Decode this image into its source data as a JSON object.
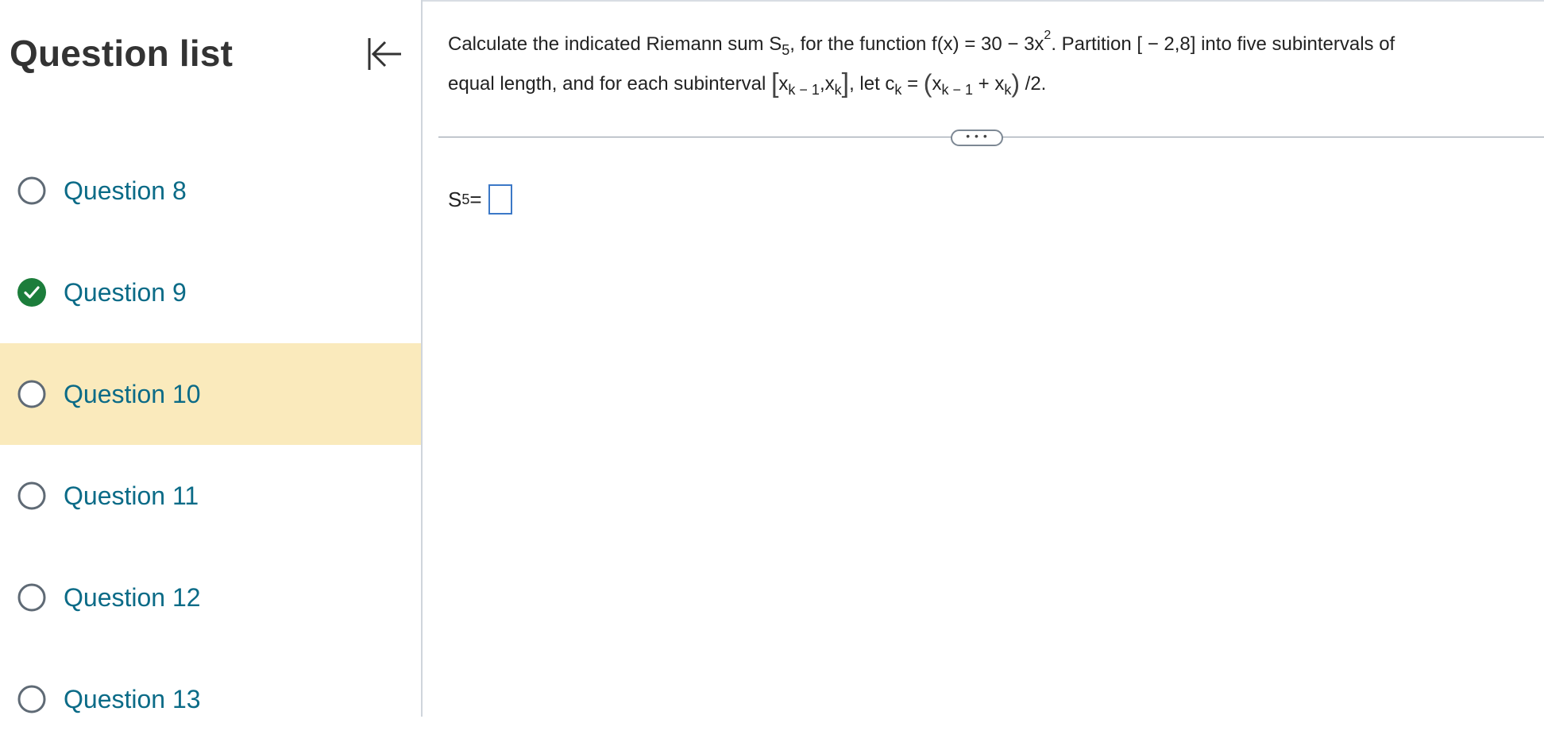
{
  "sidebar": {
    "title": "Question list",
    "collapse_icon": "collapse-left-icon",
    "items": [
      {
        "label": "Question 8",
        "status": "unanswered",
        "current": false
      },
      {
        "label": "Question 9",
        "status": "completed",
        "current": false
      },
      {
        "label": "Question 10",
        "status": "unanswered",
        "current": true
      },
      {
        "label": "Question 11",
        "status": "unanswered",
        "current": false
      },
      {
        "label": "Question 12",
        "status": "unanswered",
        "current": false
      },
      {
        "label": "Question 13",
        "status": "unanswered",
        "current": false
      }
    ]
  },
  "question": {
    "line1": {
      "lead": "Calculate the indicated Riemann sum S",
      "lead_sub": "5",
      "mid": ", for the function f(x) = 30 − 3x",
      "mid_sup": "2",
      "tail": ".  Partition [ − 2,8] into five subintervals of"
    },
    "line2": {
      "lead": "equal length, and for each subinterval",
      "interval_a": "x",
      "interval_a_sub": "k − 1",
      "interval_sep": ",",
      "interval_b": "x",
      "interval_b_sub": "k",
      "let": ", let c",
      "let_sub": "k",
      "equals": " = ",
      "sum_a": "x",
      "sum_a_sub": "k − 1",
      "plus": " + ",
      "sum_b": "x",
      "sum_b_sub": "k",
      "tail": " /2."
    },
    "more_button_label": "• • •"
  },
  "answer": {
    "label": "S",
    "label_sub": "5",
    "equals": " =",
    "value": ""
  },
  "colors": {
    "accent_link": "#0b6b87",
    "current_highlight": "#faeabc",
    "complete_green": "#1c7d3b",
    "input_border": "#3b78c7"
  }
}
